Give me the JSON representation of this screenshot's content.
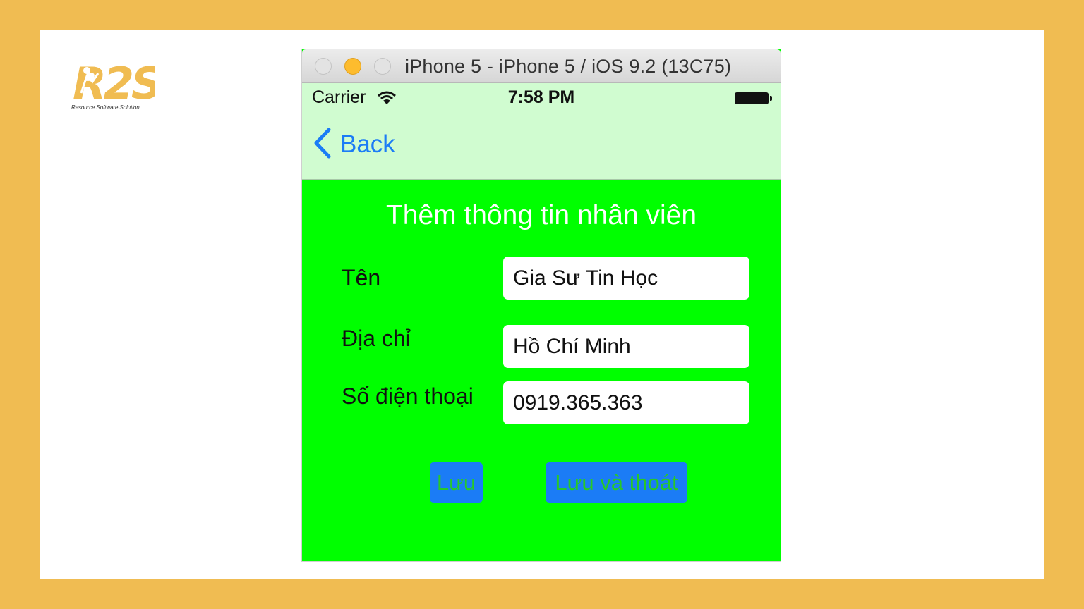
{
  "logo": {
    "mark": "R2S",
    "tagline": "Resource Software Solution",
    "color": "#f0bc52"
  },
  "window": {
    "title": "iPhone 5 - iPhone 5 / iOS 9.2 (13C75)"
  },
  "status_bar": {
    "carrier": "Carrier",
    "time": "7:58 PM",
    "wifi_icon": "wifi-icon",
    "battery_icon": "battery-icon"
  },
  "nav": {
    "back_label": "Back",
    "back_icon": "chevron-left-icon"
  },
  "form": {
    "title": "Thêm thông tin nhân viên",
    "fields": [
      {
        "label": "Tên",
        "value": "Gia Sư Tin Học"
      },
      {
        "label": "Địa chỉ",
        "value": "Hồ Chí Minh"
      },
      {
        "label": "Số điện thoại",
        "value": "0919.365.363"
      }
    ]
  },
  "buttons": {
    "save": "Lưu",
    "save_exit": "Lưu và thoát"
  },
  "colors": {
    "background": "#f0bc52",
    "nav_bar": "#d0fcd0",
    "form_background": "#00ff00",
    "ios_blue": "#1b7cf6",
    "button_text": "#28c828"
  }
}
